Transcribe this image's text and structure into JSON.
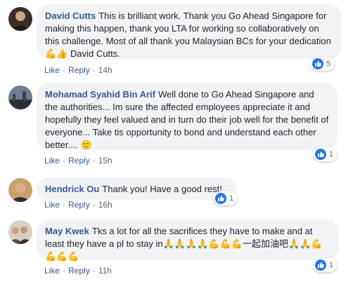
{
  "comments": [
    {
      "author": "David Cutts",
      "text": "This is brilliant work. Thank you Go Ahead Singapore for making this happen, thank you LTA for working so collaboratively on this challenge. Most of all thank you Malaysian BCs for your dedication 💪👍 David Cutts.",
      "like_label": "Like",
      "reply_label": "Reply",
      "time": "14h",
      "reaction_count": "5",
      "avatar_icon": "profile-photo"
    },
    {
      "author": "Mohamad Syahid Bin Arif",
      "text": "Well done to Go Ahead Singapore and the authorities... Im sure the affected employees appreciate it and hopefully they feel valued and in turn do their job well for the benefit of everyone... Take tis opportunity to bond and understand each other better.... 🙂",
      "like_label": "Like",
      "reply_label": "Reply",
      "time": "15h",
      "reaction_count": "1",
      "avatar_icon": "profile-photo"
    },
    {
      "author": "Hendrick Ou",
      "text": "Thank you! Have a good rest!",
      "like_label": "Like",
      "reply_label": "Reply",
      "time": "16h",
      "reaction_count": "1",
      "avatar_icon": "profile-photo"
    },
    {
      "author": "May Kwek",
      "text": "Tks a lot for all the sacrifices they have to make and at least they have a pl to stay in🙏🙏🙏🙏💪💪💪一起加油吧🙏🙏💪💪💪💪",
      "like_label": "Like",
      "reply_label": "Reply",
      "time": "11h",
      "reaction_count": "1",
      "avatar_icon": "profile-photo"
    }
  ],
  "colors": {
    "author": "#385898",
    "bubble": "#f2f3f5",
    "like_badge": "#2078f4"
  }
}
